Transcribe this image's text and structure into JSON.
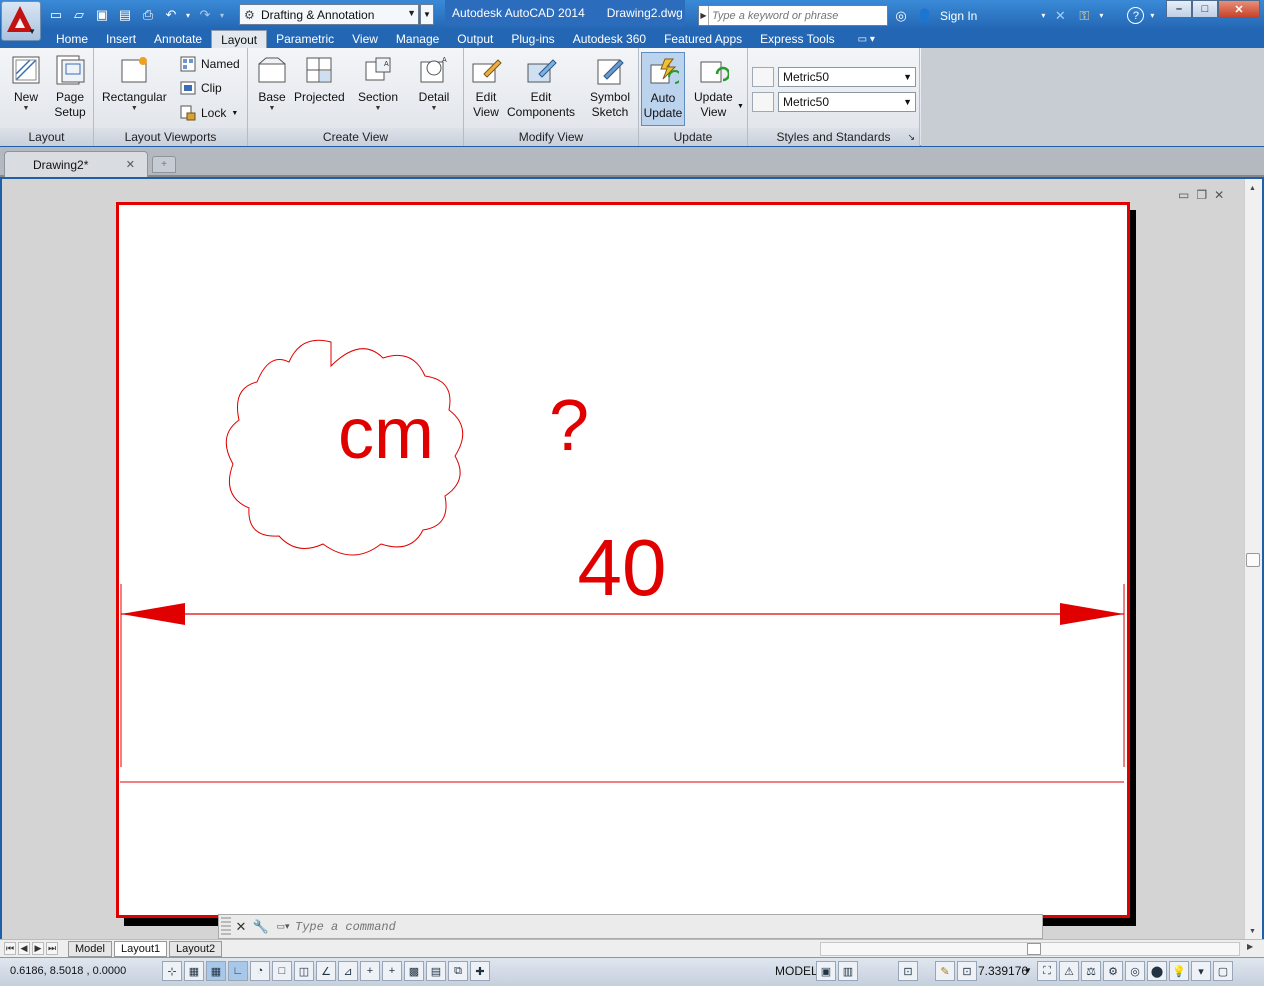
{
  "titlebar": {
    "workspace": "Drafting & Annotation",
    "app_name": "Autodesk AutoCAD 2014",
    "file_name": "Drawing2.dwg",
    "search_placeholder": "Type a keyword or phrase",
    "sign_in": "Sign In"
  },
  "ribbon_tabs": [
    "Home",
    "Insert",
    "Annotate",
    "Layout",
    "Parametric",
    "View",
    "Manage",
    "Output",
    "Plug-ins",
    "Autodesk 360",
    "Featured Apps",
    "Express Tools"
  ],
  "active_tab": "Layout",
  "panels": {
    "layout": {
      "title": "Layout",
      "new": "New",
      "page_setup_1": "Page",
      "page_setup_2": "Setup"
    },
    "viewports": {
      "title": "Layout Viewports",
      "rectangular": "Rectangular",
      "named": "Named",
      "clip": "Clip",
      "lock": "Lock"
    },
    "create_view": {
      "title": "Create View",
      "base": "Base",
      "projected": "Projected",
      "section": "Section",
      "detail": "Detail"
    },
    "modify_view": {
      "title": "Modify View",
      "edit_view_1": "Edit",
      "edit_view_2": "View",
      "edit_comp_1": "Edit",
      "edit_comp_2": "Components"
    },
    "update": {
      "title": "Update",
      "symbol_1": "Symbol",
      "symbol_2": "Sketch",
      "auto_1": "Auto",
      "auto_2": "Update",
      "upd_1": "Update",
      "upd_2": "View"
    },
    "styles": {
      "title": "Styles and Standards",
      "style1": "Metric50",
      "style2": "Metric50"
    }
  },
  "doc_tab": {
    "name": "Drawing2*"
  },
  "drawing": {
    "cloud_text": "cm",
    "question": "?",
    "dimension": "40",
    "color": "#e00000"
  },
  "command": {
    "placeholder": "Type a command"
  },
  "layout_tabs": [
    "Model",
    "Layout1",
    "Layout2"
  ],
  "active_layout": "Layout1",
  "status": {
    "coords": "0.6186, 8.5018 , 0.0000",
    "space": "MODEL",
    "scale": "7.339176"
  }
}
